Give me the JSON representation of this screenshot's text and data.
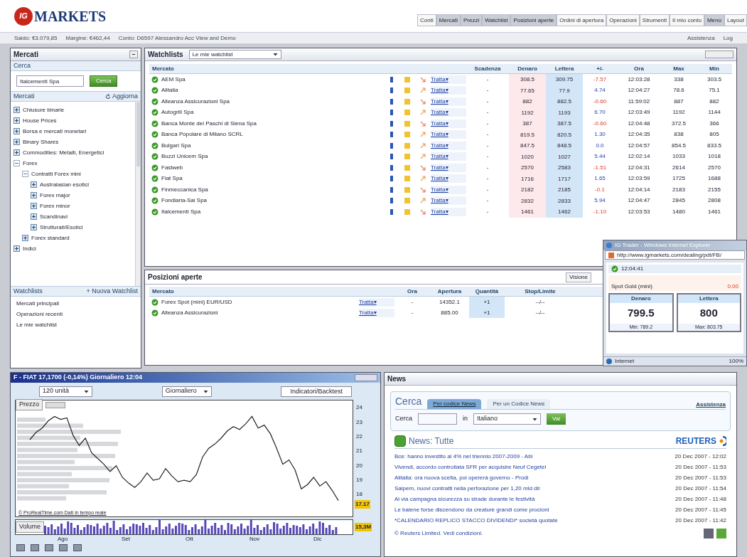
{
  "header": {
    "logo_mark": "IG",
    "logo_text": "MARKETS",
    "nav": [
      {
        "label": "Conti",
        "selected": false
      },
      {
        "label": "Mercati",
        "selected": true
      },
      {
        "label": "Prezzi",
        "selected": true
      },
      {
        "label": "Watchlist",
        "selected": true
      },
      {
        "label": "Posizioni aperte",
        "selected": true
      },
      {
        "label": "Ordini di apertura",
        "selected": false
      },
      {
        "label": "Operazioni",
        "selected": false
      },
      {
        "label": "Strumenti",
        "selected": false
      },
      {
        "label": "Il mio conto",
        "selected": false
      },
      {
        "label": "Menù",
        "selected": true
      },
      {
        "label": "Layout",
        "selected": false
      }
    ]
  },
  "account_bar": {
    "balance": "Saldo: €3.079,85",
    "margin": "Margine: €462,44",
    "account": "Conto: D6597 Alessandro Acc View and Demo",
    "links": [
      "Assistenza",
      "Log"
    ]
  },
  "markets_panel": {
    "title": "Mercati",
    "search_label": "Cerca",
    "search_value": "Italcementi Spa",
    "search_button": "Cerca",
    "tree_title": "Mercati",
    "refresh": "Aggiorna",
    "tree": [
      {
        "label": "Chiusure binarie",
        "expanded": false
      },
      {
        "label": "House Prices",
        "expanded": false
      },
      {
        "label": "Borsa e mercati monetari",
        "expanded": false
      },
      {
        "label": "Binary Shares",
        "expanded": false
      },
      {
        "label": "Commodities: Metalli, Energetici",
        "expanded": false
      },
      {
        "label": "Forex",
        "expanded": true,
        "children": [
          {
            "label": "Contratti Forex mini",
            "expanded": true,
            "children": [
              {
                "label": "Australasian esotici",
                "expanded": false
              },
              {
                "label": "Forex major",
                "expanded": false
              },
              {
                "label": "Forex minor",
                "expanded": false
              },
              {
                "label": "Scandinavi",
                "expanded": false
              },
              {
                "label": "Strutturati/Esotici",
                "expanded": false
              }
            ]
          },
          {
            "label": "Forex standard",
            "expanded": false
          }
        ]
      },
      {
        "label": "Indici",
        "expanded": false
      }
    ],
    "watchlists_title": "Watchlists",
    "new_watchlist": "+ Nuova Watchlist",
    "watchlists": [
      "Mercati principali",
      "Operazioni recenti",
      "Le mie watchlist"
    ]
  },
  "watchlist": {
    "title": "Watchlists",
    "selector": "Le mie watchlist",
    "columns": [
      "Mercato",
      "Scadenza",
      "Denaro",
      "Lettera",
      "+/-",
      "Ora",
      "Max",
      "Min"
    ],
    "rows": [
      {
        "market": "AEM Spa",
        "trade": "Tratta▾",
        "expiry": "-",
        "bid": "308.5",
        "offer": "309.75",
        "change": "-7.57",
        "falling": true,
        "time": "12:03:28",
        "high": "338",
        "low": "303.5"
      },
      {
        "market": "Alitalia",
        "trade": "Tratta▾",
        "expiry": "-",
        "bid": "77.65",
        "offer": "77.9",
        "change": "4.74",
        "falling": false,
        "time": "12:04:27",
        "high": "78.6",
        "low": "75.1"
      },
      {
        "market": "Alleanza Assicurazioni Spa",
        "trade": "Tratta▾",
        "expiry": "-",
        "bid": "882",
        "offer": "882.5",
        "change": "-0.60",
        "falling": true,
        "time": "11:59:02",
        "high": "887",
        "low": "882"
      },
      {
        "market": "Autogrill Spa",
        "trade": "Tratta▾",
        "expiry": "-",
        "bid": "1192",
        "offer": "1193",
        "change": "6.70",
        "falling": false,
        "time": "12:03:49",
        "high": "1192",
        "low": "1144"
      },
      {
        "market": "Banca Monte dei Paschi di Siena Spa",
        "trade": "Tratta▾",
        "expiry": "-",
        "bid": "387",
        "offer": "387.5",
        "change": "-0.60",
        "falling": true,
        "time": "12:04:48",
        "high": "372.5",
        "low": "366"
      },
      {
        "market": "Banca Popolare di Milano SCRL",
        "trade": "Tratta▾",
        "expiry": "-",
        "bid": "819.5",
        "offer": "820.5",
        "change": "1.30",
        "falling": false,
        "time": "12:04:35",
        "high": "838",
        "low": "805"
      },
      {
        "market": "Bulgari Spa",
        "trade": "Tratta▾",
        "expiry": "-",
        "bid": "847.5",
        "offer": "848.5",
        "change": "0.0",
        "falling": false,
        "time": "12:04:57",
        "high": "854.5",
        "low": "833.5"
      },
      {
        "market": "Buzzi Unicem Spa",
        "trade": "Tratta▾",
        "expiry": "-",
        "bid": "1020",
        "offer": "1027",
        "change": "5.44",
        "falling": false,
        "time": "12:02:14",
        "high": "1033",
        "low": "1018"
      },
      {
        "market": "Fastweb",
        "trade": "Tratta▾",
        "expiry": "-",
        "bid": "2570",
        "offer": "2583",
        "change": "-1.51",
        "falling": true,
        "time": "12:04:31",
        "high": "2614",
        "low": "2570"
      },
      {
        "market": "Fiat Spa",
        "trade": "Tratta▾",
        "expiry": "-",
        "bid": "1716",
        "offer": "1717",
        "change": "1.65",
        "falling": false,
        "time": "12:03:59",
        "high": "1725",
        "low": "1688"
      },
      {
        "market": "Finmeccanica Spa",
        "trade": "Tratta▾",
        "expiry": "-",
        "bid": "2182",
        "offer": "2185",
        "change": "-0.1",
        "falling": true,
        "time": "12:04:14",
        "high": "2183",
        "low": "2155"
      },
      {
        "market": "Fondiaria-Sai Spa",
        "trade": "Tratta▾",
        "expiry": "-",
        "bid": "2832",
        "offer": "2833",
        "change": "5.94",
        "falling": false,
        "time": "12:04:47",
        "high": "2845",
        "low": "2808"
      },
      {
        "market": "Italcementi Spa",
        "trade": "Tratta▾",
        "expiry": "-",
        "bid": "1461",
        "offer": "1462",
        "change": "-1.10",
        "falling": true,
        "time": "12:03:53",
        "high": "1480",
        "low": "1461"
      }
    ]
  },
  "positions": {
    "title": "Posizioni aperte",
    "view": "Visione",
    "columns": [
      "Mercato",
      "Ora",
      "Apertura",
      "Quantità",
      "Stop/Limite"
    ],
    "rows": [
      {
        "market": "Forex Spot (mini) EUR/USD",
        "trade": "Tratta▾",
        "time": "-",
        "open": "14352.1",
        "size": "+1",
        "stop": "--/--"
      },
      {
        "market": "Alleanza Assicurazioni",
        "trade": "Tratta▾",
        "time": "-",
        "open": "885.00",
        "size": "+1",
        "stop": "--/--"
      }
    ]
  },
  "popup": {
    "title": "IG Trader - Windows Internet Explorer",
    "url": "http://www.igmarkets.com/dealing/pdt/FB/",
    "time": "12:04:41",
    "market": "Spot Gold (mini)",
    "change": "0.00",
    "bid_label": "Denaro",
    "bid": "799.5",
    "bid_sub": "Min: 789.2",
    "offer_label": "Lettera",
    "offer": "800",
    "offer_sub": "Max: 803.75",
    "zone": "Internet",
    "zoom": "100%"
  },
  "chart_window": {
    "title": "F - FIAT  17,1700 (-0,14%)  Giornaliero 12:04",
    "period": "120 unità",
    "interval": "Giornaliero",
    "indicators": "Indicatori/Backtest",
    "last_price": "17.17",
    "credit": "© ProRealTime.com  Dati in tempo reale",
    "volume_label": "Volume",
    "last_volume": "15,3M",
    "month_labels": [
      "Ago",
      "Set",
      "Ott",
      "Nov",
      "Dic"
    ],
    "chart_data": {
      "type": "line",
      "ylim": [
        16.5,
        24.5
      ],
      "yticks": [
        18,
        19,
        20,
        21,
        22,
        23,
        24
      ],
      "series": [
        {
          "name": "Prezzo",
          "color": "#222222",
          "values": [
            21.8,
            22.3,
            22.6,
            23.1,
            23.4,
            23.2,
            23.3,
            22.1,
            21.4,
            21.9,
            20.9,
            20.5,
            20.1,
            19.6,
            20.0,
            19.2,
            18.8,
            18.5,
            18.9,
            19.5,
            19.0,
            19.1,
            19.8,
            19.3,
            18.9,
            19.0,
            18.9,
            19.4,
            20.6,
            21.2,
            21.5,
            21.9,
            22.4,
            22.7,
            22.5,
            22.9,
            23.4,
            22.6,
            22.8,
            22.2,
            21.2,
            20.1,
            20.4,
            19.7,
            18.4,
            18.7,
            19.2,
            18.6,
            18.9,
            18.3,
            17.6
          ]
        }
      ]
    }
  },
  "news": {
    "title": "News",
    "search_title": "Cerca",
    "tabs": [
      {
        "label": "Per codice News",
        "selected": true
      },
      {
        "label": "Per un Codice News",
        "selected": false
      }
    ],
    "help": "Assistenza",
    "search_label": "Cerca",
    "in_label": "in",
    "language": "Italiano",
    "go": "Vai",
    "heading": "News: Tutte",
    "source": "REUTERS",
    "items": [
      {
        "headline": "Bce: hanno investito al 4% nel triennio 2007-2009 - Abi",
        "date": "20 Dec 2007 - 12:02"
      },
      {
        "headline": "Vivendi, accordo controllata SFR per acquisire Neuf Cegetel",
        "date": "20 Dec 2007 - 11:53"
      },
      {
        "headline": "Alitalia: ora nuova scelta, poi opererà governo - Prodi",
        "date": "20 Dec 2007 - 11:53"
      },
      {
        "headline": "Saipem, nuovi contratti nella perforazione per 1,20 mld dlr",
        "date": "20 Dec 2007 - 11:54"
      },
      {
        "headline": "Al via campagna sicurezza su strade durante le festività",
        "date": "20 Dec 2007 - 11:48"
      },
      {
        "headline": "Le balene forse discendono da creature grandi come procioni",
        "date": "20 Dec 2007 - 11:45"
      },
      {
        "headline": "*CALENDARIO REPLICO STACCO DIVIDENDI* società quotate",
        "date": "20 Dec 2007 - 11:42"
      }
    ],
    "footer": "© Reuters Limited. Vedi condizioni."
  }
}
